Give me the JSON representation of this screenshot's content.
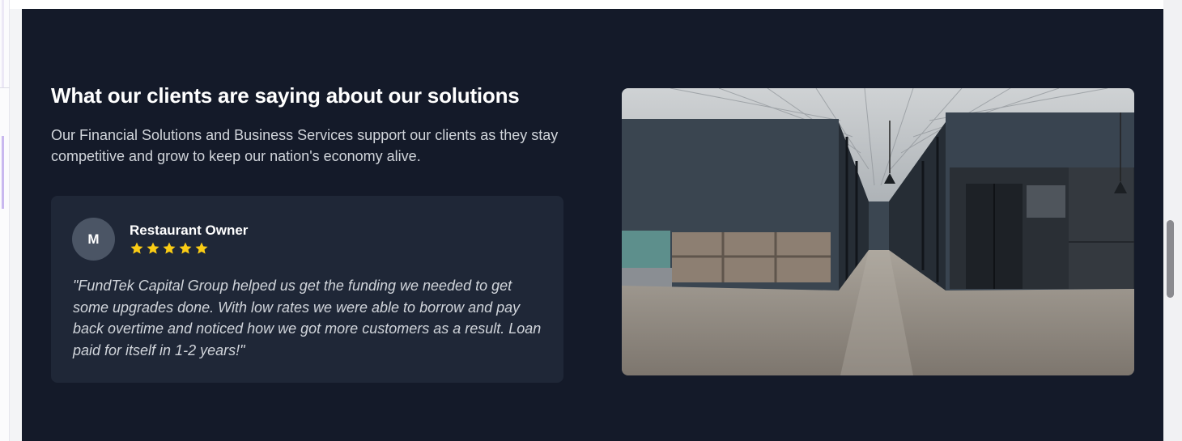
{
  "section": {
    "heading": "What our clients are saying about our solutions",
    "subtext": "Our Financial Solutions and Business Services support our clients as they stay competitive and grow to keep our nation's economy alive."
  },
  "testimonial": {
    "avatar_initial": "M",
    "author": "Restaurant Owner",
    "rating": 5,
    "rating_max": 5,
    "quote": "\"FundTek Capital Group helped us get the funding we needed to get some upgrades done. With low rates we were able to borrow and pay back overtime and noticed how we got more customers as a result. Loan paid for itself in 1-2 years!\""
  },
  "image": {
    "alt": "Modern office corridor with kitchen area"
  },
  "colors": {
    "section_bg": "#141a29",
    "card_bg": "#1f2737",
    "avatar_bg": "#4b5565",
    "star": "#facc15",
    "heading": "#ffffff",
    "body_text": "#d1d5db"
  },
  "icons": {
    "star": "star-icon"
  }
}
